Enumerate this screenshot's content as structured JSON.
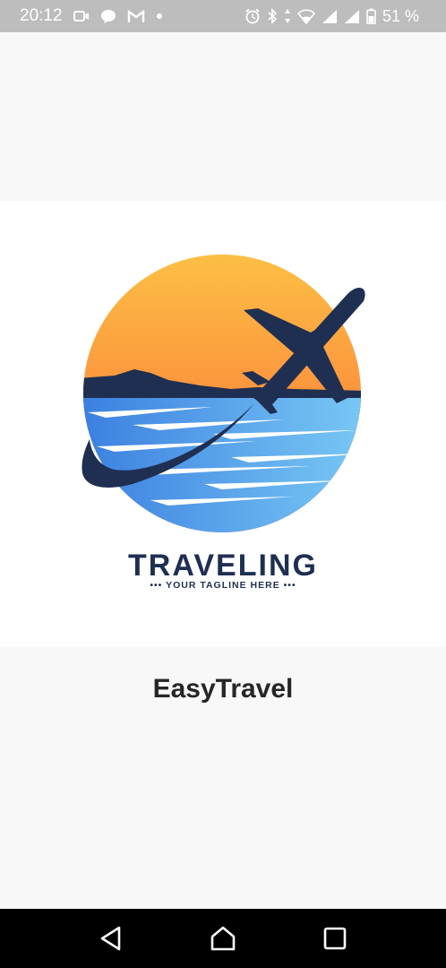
{
  "status_bar": {
    "time": "20:12",
    "battery": "51 %",
    "left_icons": [
      "video-icon",
      "chat-bubble-icon",
      "gmail-icon",
      "notification-dot-icon"
    ],
    "right_icons": [
      "alarm-icon",
      "bluetooth-icon",
      "data-arrows-icon",
      "wifi-icon",
      "signal-icon",
      "signal-icon",
      "battery-icon"
    ]
  },
  "logo": {
    "brand": "TRAVELING",
    "tagline": "••• YOUR TAGLINE HERE •••",
    "colors": {
      "navy": "#1f2f52",
      "sun_top": "#fdbf45",
      "sun_bottom": "#fa6a3a",
      "water_light": "#79c8f5",
      "water_dark": "#3b7fe0"
    }
  },
  "app": {
    "name": "EasyTravel"
  },
  "nav_bar": {
    "buttons": [
      "back-icon",
      "home-icon",
      "recents-icon"
    ]
  }
}
